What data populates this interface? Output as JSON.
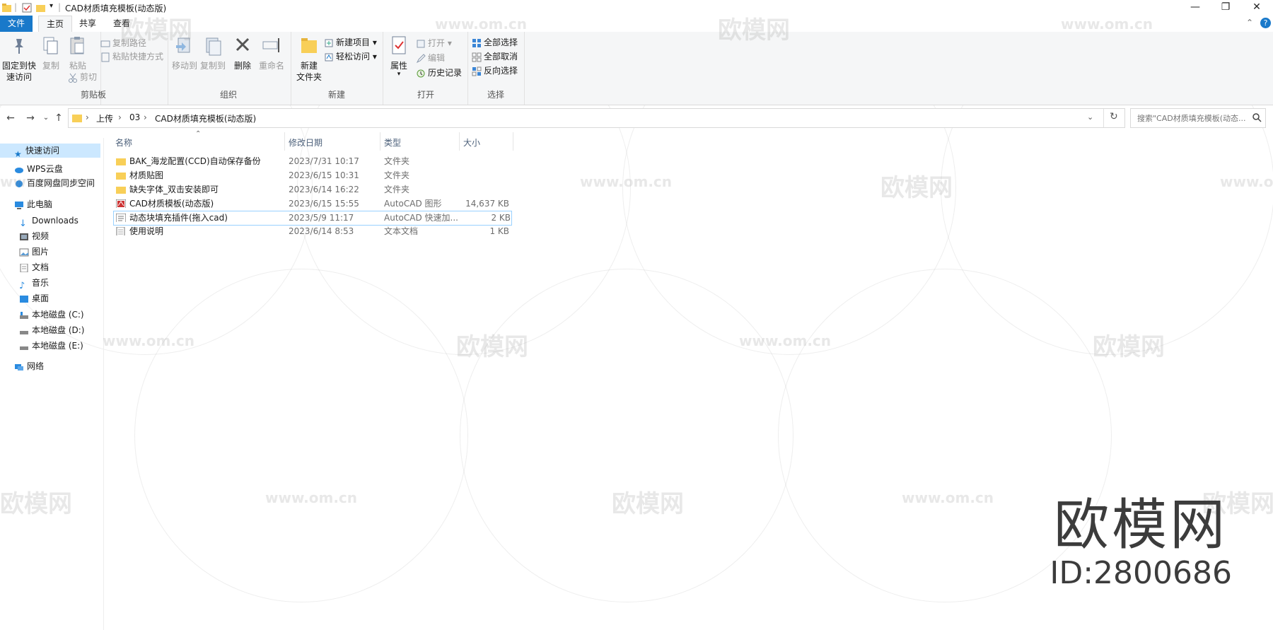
{
  "window": {
    "title": "CAD材质填充模板(动态版)",
    "controls": {
      "minimize": "—",
      "maximize": "❐",
      "close": "✕"
    }
  },
  "ribbon_tabs": [
    {
      "label": "文件"
    },
    {
      "label": "主页"
    },
    {
      "label": "共享"
    },
    {
      "label": "查看"
    }
  ],
  "ribbon": {
    "clipboard": {
      "group_label": "剪贴板",
      "pin_label": "固定到快\n速访问",
      "copy_label": "复制",
      "paste_label": "粘贴",
      "copy_path_label": "复制路径",
      "paste_shortcut_label": "粘贴快捷方式",
      "cut_label": "剪切"
    },
    "organize": {
      "group_label": "组织",
      "move_to_label": "移动到",
      "copy_to_label": "复制到",
      "delete_label": "删除",
      "rename_label": "重命名"
    },
    "new": {
      "group_label": "新建",
      "new_folder_label": "新建\n文件夹",
      "new_item_label": "新建项目 ▾",
      "easy_access_label": "轻松访问 ▾"
    },
    "open": {
      "group_label": "打开",
      "properties_label": "属性",
      "open_label": "打开 ▾",
      "edit_label": "编辑",
      "history_label": "历史记录"
    },
    "select": {
      "group_label": "选择",
      "select_all_label": "全部选择",
      "select_none_label": "全部取消",
      "invert_label": "反向选择"
    }
  },
  "address": {
    "breadcrumbs": [
      "上传",
      "03",
      "CAD材质填充模板(动态版)"
    ],
    "separator": "›",
    "search_placeholder": "搜索\"CAD材质填充模板(动态..."
  },
  "nav_pane": [
    {
      "label": "快速访问",
      "icon": "star-icon",
      "indent": 0
    },
    {
      "label": "WPS云盘",
      "icon": "cloud-icon",
      "indent": 0
    },
    {
      "label": "百度网盘同步空间",
      "icon": "baidu-icon",
      "indent": 0
    },
    {
      "label": "此电脑",
      "icon": "pc-icon",
      "indent": 0
    },
    {
      "label": "Downloads",
      "icon": "download-icon",
      "indent": 1
    },
    {
      "label": "视频",
      "icon": "video-icon",
      "indent": 1
    },
    {
      "label": "图片",
      "icon": "picture-icon",
      "indent": 1
    },
    {
      "label": "文档",
      "icon": "document-icon",
      "indent": 1
    },
    {
      "label": "音乐",
      "icon": "music-icon",
      "indent": 1
    },
    {
      "label": "桌面",
      "icon": "desktop-icon",
      "indent": 1
    },
    {
      "label": "本地磁盘 (C:)",
      "icon": "drive-icon",
      "indent": 1
    },
    {
      "label": "本地磁盘 (D:)",
      "icon": "drive-icon",
      "indent": 1
    },
    {
      "label": "本地磁盘 (E:)",
      "icon": "drive-icon",
      "indent": 1
    },
    {
      "label": "网络",
      "icon": "network-icon",
      "indent": 0
    }
  ],
  "columns": {
    "name": "名称",
    "date": "修改日期",
    "type": "类型",
    "size": "大小"
  },
  "files": [
    {
      "name": "BAK_海龙配置(CCD)自动保存备份",
      "date": "2023/7/31 10:17",
      "type": "文件夹",
      "size": "",
      "icon": "folder-icon"
    },
    {
      "name": "材质贴图",
      "date": "2023/6/15 10:31",
      "type": "文件夹",
      "size": "",
      "icon": "folder-icon"
    },
    {
      "name": "缺失字体_双击安装即可",
      "date": "2023/6/14 16:22",
      "type": "文件夹",
      "size": "",
      "icon": "folder-icon"
    },
    {
      "name": "CAD材质模板(动态版)",
      "date": "2023/6/15 15:55",
      "type": "AutoCAD 图形",
      "size": "14,637 KB",
      "icon": "dwg-icon"
    },
    {
      "name": "动态块填充插件(拖入cad)",
      "date": "2023/5/9 11:17",
      "type": "AutoCAD 快速加...",
      "size": "2 KB",
      "icon": "plugin-icon"
    },
    {
      "name": "使用说明",
      "date": "2023/6/14 8:53",
      "type": "文本文档",
      "size": "1 KB",
      "icon": "txt-icon"
    }
  ],
  "watermark": {
    "brand": "欧模网",
    "site": "www.om.cn",
    "id": "ID:2800686"
  },
  "colors": {
    "accent": "#1979ca",
    "selection_border": "#99d1ff",
    "folder": "#f8cf58"
  }
}
